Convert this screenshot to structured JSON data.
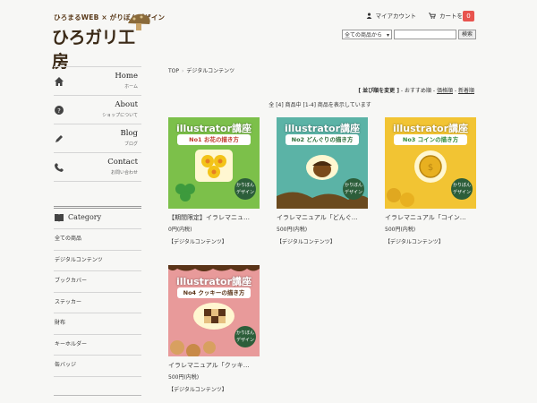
{
  "logo": {
    "tagline": "ひろまるWEB × がりぼんデザイン",
    "name": "ひろガリ工房"
  },
  "header": {
    "account": "マイアカウント",
    "cart": "カートを見る",
    "cart_count": "0"
  },
  "search": {
    "category": "全ての商品から",
    "button": "検索"
  },
  "nav": [
    {
      "title": "Home",
      "sub": "ホーム"
    },
    {
      "title": "About",
      "sub": "ショップについて"
    },
    {
      "title": "Blog",
      "sub": "ブログ"
    },
    {
      "title": "Contact",
      "sub": "お問い合わせ"
    }
  ],
  "category": {
    "title": "Category",
    "items": [
      "全ての商品",
      "デジタルコンテンツ",
      "ブックカバー",
      "ステッカー",
      "財布",
      "キーホルダー",
      "缶バッジ"
    ]
  },
  "breadcrumb": {
    "home": "TOP",
    "sep": "›",
    "current": "デジタルコンテンツ"
  },
  "sort": {
    "label": "[ 並び順を変更 ]",
    "current": "おすすめ順",
    "opt1": "価格順",
    "opt2": "新着順",
    "dash": " - "
  },
  "count_text": "全 [4] 商品中 [1-4] 商品を表示しています",
  "products": [
    {
      "name": "【期間限定】イラレマニュ…",
      "price": "0円(内税)",
      "category": "【デジタルコンテンツ】",
      "course": "illustrator講座",
      "sub": "No1 お花の描き方",
      "bg": "#7cc04a",
      "badge": "かりぼんデザイン"
    },
    {
      "name": "イラレマニュアル「どんぐ…",
      "price": "500円(内税)",
      "category": "【デジタルコンテンツ】",
      "course": "illustrator講座",
      "sub": "No2 どんぐりの描き方",
      "bg": "#5bb3a6",
      "badge": "かりぼんデザイン"
    },
    {
      "name": "イラレマニュアル「コイン…",
      "price": "500円(内税)",
      "category": "【デジタルコンテンツ】",
      "course": "illustrator講座",
      "sub": "No3 コインの描き方",
      "bg": "#f2c433",
      "badge": "かりぼんデザイン"
    },
    {
      "name": "イラレマニュアル「クッキ…",
      "price": "500円(内税)",
      "category": "【デジタルコンテンツ】",
      "course": "illustrator講座",
      "sub": "No4 クッキーの描き方",
      "bg": "#e89a9a",
      "badge": "かりぼんデザイン"
    }
  ]
}
